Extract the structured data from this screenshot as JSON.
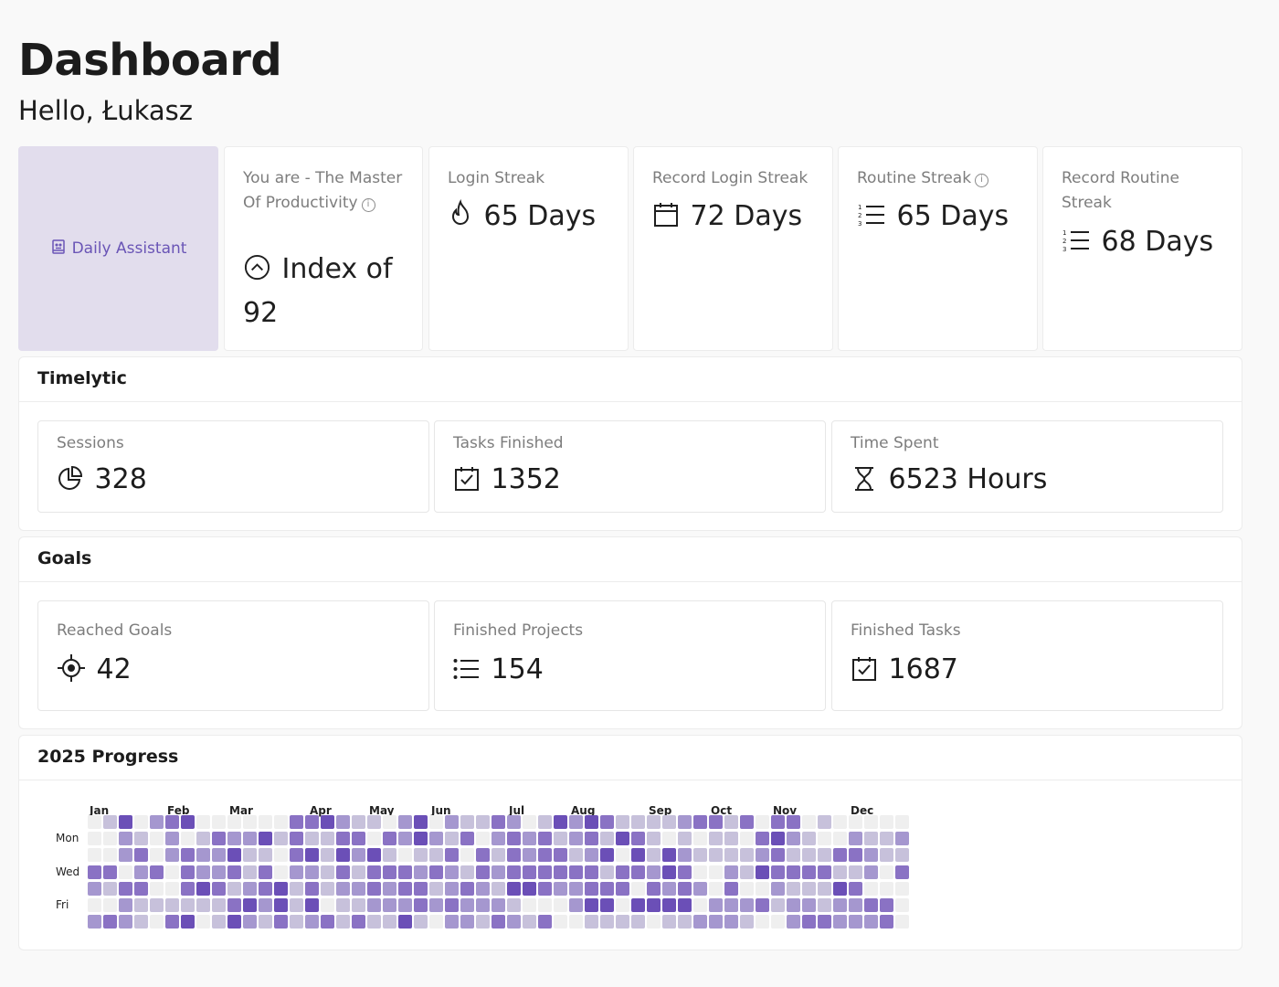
{
  "header": {
    "title": "Dashboard",
    "greeting": "Hello, Łukasz"
  },
  "assistant": {
    "label": "Daily Assistant",
    "icon": "assistant-icon"
  },
  "cards": [
    {
      "label": "You are - The Master Of Productivity",
      "info": true,
      "value": "Index of 92",
      "icon": "chevron-up-circle-icon"
    },
    {
      "label": "Login Streak",
      "value": "65 Days",
      "icon": "flame-icon"
    },
    {
      "label": "Record Login Streak",
      "value": "72 Days",
      "icon": "calendar-icon"
    },
    {
      "label": "Routine Streak",
      "info": true,
      "value": "65 Days",
      "icon": "numbered-list-icon"
    },
    {
      "label": "Record Routine Streak",
      "value": "68 Days",
      "icon": "numbered-list-icon"
    }
  ],
  "timelytic": {
    "title": "Timelytic",
    "stats": [
      {
        "label": "Sessions",
        "value": "328",
        "icon": "pie-chart-icon"
      },
      {
        "label": "Tasks Finished",
        "value": "1352",
        "icon": "calendar-check-icon"
      },
      {
        "label": "Time Spent",
        "value": "6523 Hours",
        "icon": "hourglass-icon"
      }
    ]
  },
  "goals": {
    "title": "Goals",
    "stats": [
      {
        "label": "Reached Goals",
        "value": "42",
        "icon": "target-icon"
      },
      {
        "label": "Finished Projects",
        "value": "154",
        "icon": "list-icon"
      },
      {
        "label": "Finished Tasks",
        "value": "1687",
        "icon": "calendar-check-icon"
      }
    ]
  },
  "progress": {
    "title": "2025 Progress",
    "months": [
      "Jan",
      "Feb",
      "Mar",
      "Apr",
      "May",
      "Jun",
      "Jul",
      "Aug",
      "Sep",
      "Oct",
      "Nov",
      "Dec"
    ],
    "days": [
      "Mon",
      "Wed",
      "Fri"
    ],
    "colors": [
      "#efefef",
      "#c7c1db",
      "#a597cf",
      "#8a72c4",
      "#6b4fb7"
    ],
    "rows": [
      "01402340000003342110240211320142431111233130330100000",
      "00210201322413113303242130232312314310101103421002112",
      "00230232241103414241011303132331240414211112311133211",
      "33023032231302213133323213233333313324300214333311203",
      "21330034312341312232331232144322333032320300211143000",
      "00211111134241401122232322210002440444402223122122330",
      "23210340142131231311410221321300111101122210023322230"
    ]
  }
}
